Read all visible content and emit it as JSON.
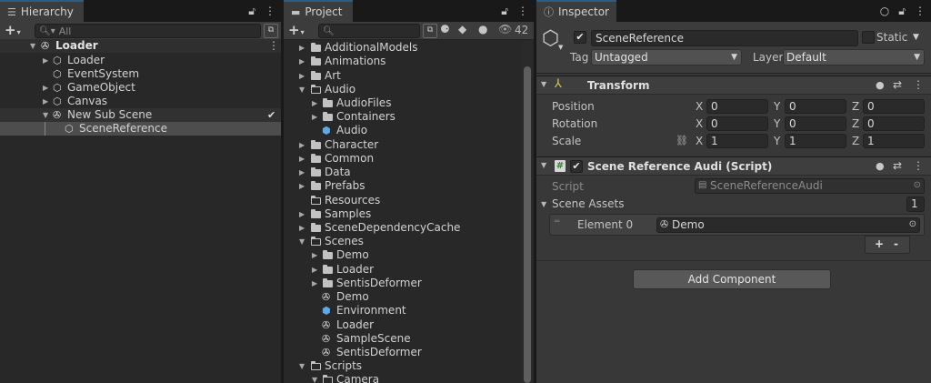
{
  "hierarchy": {
    "tab_label": "Hierarchy",
    "search_placeholder": "All",
    "root": "Loader",
    "items": [
      {
        "label": "Loader"
      },
      {
        "label": "EventSystem"
      },
      {
        "label": "GameObject"
      },
      {
        "label": "Canvas"
      },
      {
        "label": "New Sub Scene"
      },
      {
        "label": "SceneReference"
      }
    ]
  },
  "project": {
    "tab_label": "Project",
    "hidden_count": "42",
    "items": [
      {
        "label": "AdditionalModels"
      },
      {
        "label": "Animations"
      },
      {
        "label": "Art"
      },
      {
        "label": "Audio"
      },
      {
        "label": "AudioFiles"
      },
      {
        "label": "Containers"
      },
      {
        "label": "Audio"
      },
      {
        "label": "Character"
      },
      {
        "label": "Common"
      },
      {
        "label": "Data"
      },
      {
        "label": "Prefabs"
      },
      {
        "label": "Resources"
      },
      {
        "label": "Samples"
      },
      {
        "label": "SceneDependencyCache"
      },
      {
        "label": "Scenes"
      },
      {
        "label": "Demo"
      },
      {
        "label": "Loader"
      },
      {
        "label": "SentisDeformer"
      },
      {
        "label": "Demo"
      },
      {
        "label": "Environment"
      },
      {
        "label": "Loader"
      },
      {
        "label": "SampleScene"
      },
      {
        "label": "SentisDeformer"
      },
      {
        "label": "Scripts"
      },
      {
        "label": "Camera"
      }
    ]
  },
  "inspector": {
    "tab_label": "Inspector",
    "object_name": "SceneReference",
    "static_label": "Static",
    "tag_label": "Tag",
    "tag_value": "Untagged",
    "layer_label": "Layer",
    "layer_value": "Default",
    "transform": {
      "title": "Transform",
      "rows": [
        {
          "label": "Position",
          "x": "0",
          "y": "0",
          "z": "0"
        },
        {
          "label": "Rotation",
          "x": "0",
          "y": "0",
          "z": "0"
        },
        {
          "label": "Scale",
          "x": "1",
          "y": "1",
          "z": "1"
        }
      ],
      "axis_x": "X",
      "axis_y": "Y",
      "axis_z": "Z"
    },
    "script_component": {
      "title": "Scene Reference Audi (Script)",
      "script_label": "Script",
      "script_value": "SceneReferenceAudi",
      "list_label": "Scene Assets",
      "list_count": "1",
      "element_label": "Element 0",
      "element_value": "Demo",
      "plus": "+",
      "minus": "-"
    },
    "add_component": "Add Component"
  }
}
